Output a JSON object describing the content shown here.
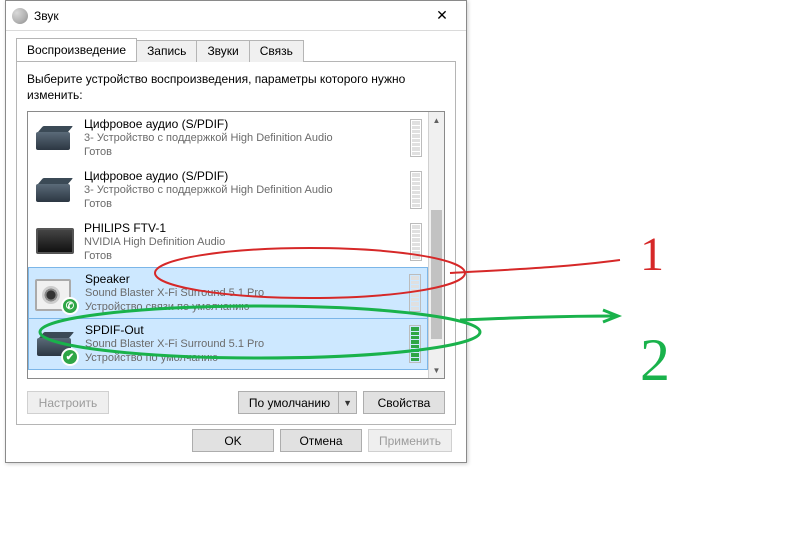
{
  "window": {
    "title": "Звук",
    "tabs": [
      "Воспроизведение",
      "Запись",
      "Звуки",
      "Связь"
    ],
    "active_tab": 0,
    "instruction": "Выберите устройство воспроизведения, параметры которого нужно изменить:"
  },
  "devices": [
    {
      "name": "Цифровое аудио (S/PDIF)",
      "sub": "3- Устройство с поддержкой High Definition Audio",
      "status": "Готов",
      "icon": "box",
      "selected": false,
      "vu_active": false
    },
    {
      "name": "Цифровое аудио (S/PDIF)",
      "sub": "3- Устройство с поддержкой High Definition Audio",
      "status": "Готов",
      "icon": "box",
      "selected": false,
      "vu_active": false
    },
    {
      "name": "PHILIPS FTV-1",
      "sub": "NVIDIA High Definition Audio",
      "status": "Готов",
      "icon": "monitor",
      "selected": false,
      "vu_active": false
    },
    {
      "name": "Speaker",
      "sub": "Sound Blaster X-Fi Surround 5.1 Pro",
      "status": "Устройство связи по умолчанию",
      "icon": "speaker",
      "badge": "phone",
      "selected": true,
      "vu_active": false
    },
    {
      "name": "SPDIF-Out",
      "sub": "Sound Blaster X-Fi Surround 5.1 Pro",
      "status": "Устройство по умолчанию",
      "icon": "box",
      "badge": "check",
      "selected": true,
      "vu_active": true
    }
  ],
  "buttons": {
    "configure": "Настроить",
    "set_default": "По умолчанию",
    "properties": "Свойства",
    "ok": "OK",
    "cancel": "Отмена",
    "apply": "Применить"
  },
  "annotations": {
    "label1": "1",
    "label2": "2",
    "color1": "#d62828",
    "color2": "#19b24b"
  }
}
